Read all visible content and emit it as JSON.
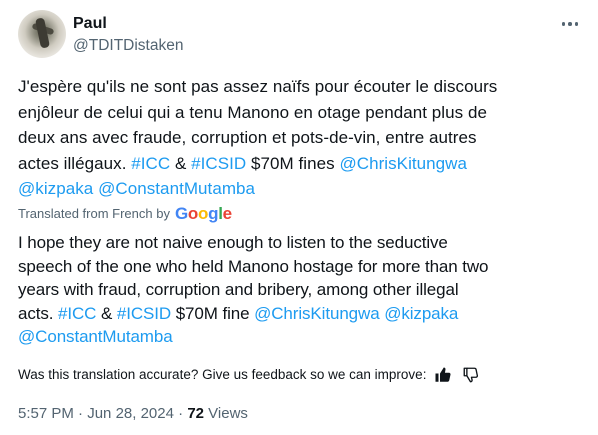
{
  "author": {
    "name": "Paul",
    "handle": "@TDITDistaken"
  },
  "tweet": {
    "original_text": "J'espère qu'ils ne sont pas assez naïfs pour écouter le discours\nenjôleur de celui qui a tenu Manono en otage pendant plus de\ndeux ans avec fraude, corruption et pots-de-vin, entre autres\nactes illégaux.",
    "original_hashtag1": "#ICC",
    "amp1": " & ",
    "original_hashtag2": "#ICSID",
    "original_fine": " $70M fines ",
    "original_mention1": "@ChrisKitungwa",
    "original_mention2": "@kizpaka",
    "original_mention3": "@ConstantMutamba",
    "translated_label": "Translated from French by",
    "google": [
      "G",
      "o",
      "o",
      "g",
      "l",
      "e"
    ],
    "translated_text": "I hope they are not naive enough to listen to the seductive\nspeech of the one who held Manono hostage for more than two\nyears with fraud, corruption and bribery, among other illegal\nacts.",
    "translated_hashtag1": "#ICC",
    "amp2": " & ",
    "translated_hashtag2": "#ICSID",
    "translated_fine": " $70M fine ",
    "translated_mention1": "@ChrisKitungwa",
    "translated_mention2": "@kizpaka",
    "translated_mention3": "@ConstantMutamba",
    "feedback_prompt": "Was this translation accurate? Give us feedback so we can improve:",
    "time": "5:57 PM",
    "sep1": " · ",
    "date": "Jun 28, 2024",
    "sep2": " · ",
    "views_count": "72",
    "views_label": "Views"
  },
  "colors": {
    "link": "#1d9bf0",
    "secondary_text": "#536471",
    "primary_text": "#0f1419"
  },
  "icons": [
    "more-icon",
    "thumbs-up-icon",
    "thumbs-down-icon"
  ]
}
